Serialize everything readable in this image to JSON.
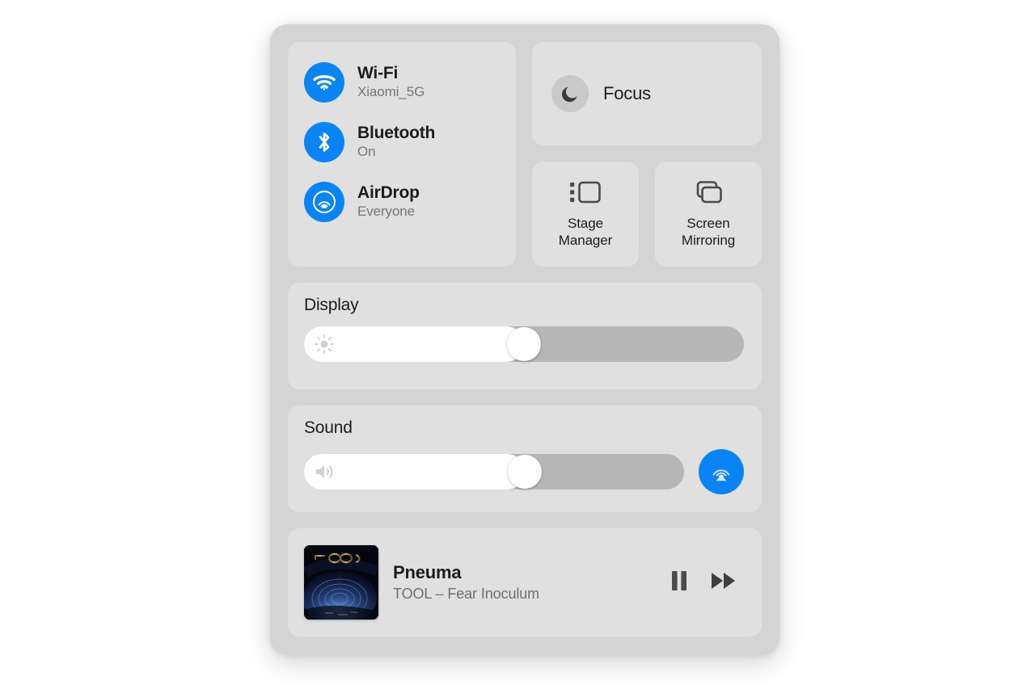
{
  "panel": {
    "name": "Control Center",
    "background_color": "#d4d4d4",
    "tile_color": "#e0e0e0",
    "accent_color": "#0a84f5"
  },
  "connectivity": {
    "items": [
      {
        "icon": "wifi-icon",
        "label": "Wi-Fi",
        "status": "Xiaomi_5G",
        "active": true
      },
      {
        "icon": "bluetooth-icon",
        "label": "Bluetooth",
        "status": "On",
        "active": true
      },
      {
        "icon": "airdrop-icon",
        "label": "AirDrop",
        "status": "Everyone",
        "active": true
      }
    ]
  },
  "focus": {
    "icon": "moon-icon",
    "label": "Focus",
    "active": false
  },
  "quick_tiles": [
    {
      "icon": "stage-manager-icon",
      "line1": "Stage",
      "line2": "Manager"
    },
    {
      "icon": "screen-mirroring-icon",
      "line1": "Screen",
      "line2": "Mirroring"
    }
  ],
  "display": {
    "heading": "Display",
    "icon": "brightness-icon",
    "value_percent": 50
  },
  "sound": {
    "heading": "Sound",
    "icon": "speaker-icon",
    "value_percent": 58,
    "output_button_icon": "airplay-icon"
  },
  "now_playing": {
    "artwork": "album-art-fear-inoculum",
    "title": "Pneuma",
    "subtitle": "TOOL – Fear Inoculum",
    "controls": [
      {
        "icon": "pause-icon",
        "name": "pause-button"
      },
      {
        "icon": "fast-forward-icon",
        "name": "next-button"
      }
    ]
  }
}
